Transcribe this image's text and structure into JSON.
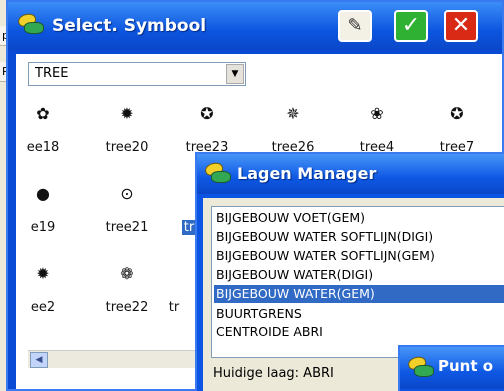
{
  "background_app": {
    "rows": [
      "p",
      "Pa"
    ]
  },
  "select_window": {
    "title": "Select. Symbool",
    "buttons": {
      "edit": "✎",
      "ok": "✓",
      "close": "✕"
    },
    "combo": {
      "value": "TREE",
      "arrow": "▼"
    },
    "symbols": [
      {
        "label": "ee18",
        "glyph": "✿"
      },
      {
        "label": "tree20",
        "glyph": "✹"
      },
      {
        "label": "tree23",
        "glyph": "✪"
      },
      {
        "label": "tree26",
        "glyph": "✵"
      },
      {
        "label": "tree4",
        "glyph": "❀"
      },
      {
        "label": "tree7",
        "glyph": "✪"
      },
      {
        "label": "e19",
        "glyph": "●"
      },
      {
        "label": "tree21",
        "glyph": "⊙"
      },
      {
        "label": "tr",
        "glyph": ""
      },
      {
        "label": "ee2",
        "glyph": "✹"
      },
      {
        "label": "tree22",
        "glyph": "❁"
      },
      {
        "label": "tr",
        "glyph": ""
      }
    ],
    "scroll_left": "◀"
  },
  "lagen_window": {
    "title": "Lagen Manager",
    "layers": [
      "BIJGEBOUW VOET(GEM)",
      "BIJGEBOUW WATER SOFTLIJN(DIGI)",
      "BIJGEBOUW WATER SOFTLIJN(GEM)",
      "BIJGEBOUW WATER(DIGI)",
      "BIJGEBOUW WATER(GEM)",
      "BUURTGRENS",
      "CENTROIDE ABRI"
    ],
    "selected_index": 4,
    "current_layer": "Huidige laag: ABRI"
  },
  "punt_window": {
    "title": "Punt o"
  },
  "colors": {
    "title_blue": "#0a4bd6",
    "selection": "#316ac5",
    "ok_green": "#2fb233",
    "close_red": "#d92a16"
  }
}
